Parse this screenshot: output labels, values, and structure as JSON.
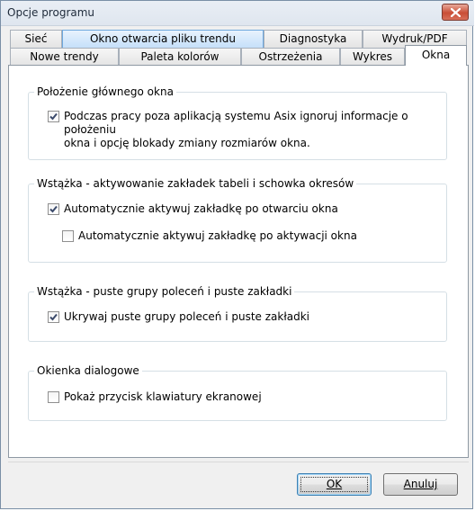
{
  "window": {
    "title": "Opcje programu"
  },
  "tabs_row1": [
    "Sieć",
    "Okno otwarcia pliku trendu",
    "Diagnostyka",
    "Wydruk/PDF"
  ],
  "tabs_row2": [
    "Nowe trendy",
    "Paleta kolorów",
    "Ostrzeżenia",
    "Wykres",
    "Okna"
  ],
  "active_tab": "Okna",
  "groups": [
    {
      "legend": "Położenie głównego okna",
      "checks": [
        {
          "line1": "Podczas pracy poza aplikacją systemu Asix ignoruj informacje o położeniu",
          "line2": "okna i opcję blokady zmiany rozmiarów okna.",
          "checked": true
        }
      ]
    },
    {
      "legend": "Wstążka - aktywowanie zakładek tabeli i schowka okresów",
      "checks": [
        {
          "line1": "Automatycznie aktywuj zakładkę po otwarciu okna",
          "checked": true
        },
        {
          "line1": "Automatycznie aktywuj zakładkę po aktywacji okna",
          "checked": false
        }
      ]
    },
    {
      "legend": "Wstążka - puste grupy poleceń i puste zakładki",
      "checks": [
        {
          "line1": "Ukrywaj puste grupy poleceń i puste zakładki",
          "checked": true
        }
      ]
    },
    {
      "legend": "Okienka dialogowe",
      "checks": [
        {
          "line1": "Pokaż przycisk klawiatury ekranowej",
          "checked": false
        }
      ]
    }
  ],
  "buttons": {
    "ok": "OK",
    "cancel": "Anuluj"
  },
  "icons": {
    "close": "close-icon",
    "check": "checkmark-icon"
  }
}
